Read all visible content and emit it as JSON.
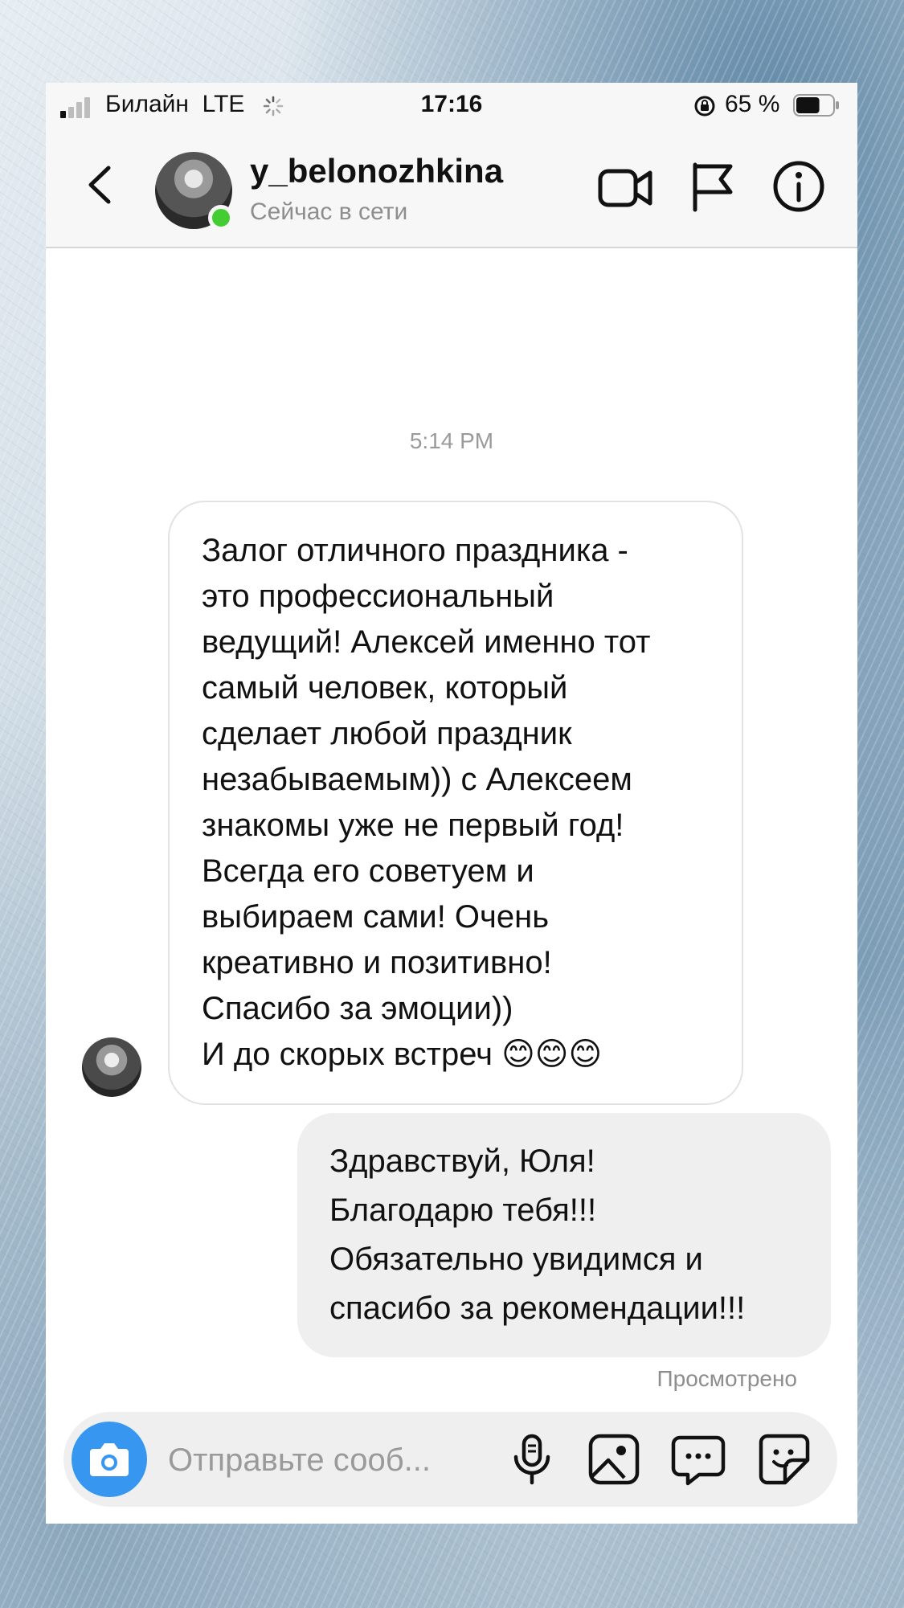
{
  "status_bar": {
    "carrier": "Билайн",
    "network": "LTE",
    "time": "17:16",
    "battery_percent": "65 %",
    "battery_level": 0.65,
    "signal_bars_active": 1
  },
  "header": {
    "username": "y_belonozhkina",
    "presence": "Сейчас в сети",
    "online_color": "#44cc33"
  },
  "thread": {
    "timestamp": "5:14 PM",
    "incoming_message": "Залог отличного праздника -\nэто профессиональный\nведущий! Алексей именно тот\nсамый человек, который\nсделает любой праздник\nнезабываемым)) с Алексеем\nзнакомы уже не первый год!\nВсегда его советуем и\nвыбираем сами! Очень\nкреативно и позитивно!\nСпасибо за эмоции))\nИ до скорых встреч 😊😊😊",
    "outgoing_message": "Здравствуй, Юля!\nБлагодарю тебя!!!\nОбязательно увидимся и\nспасибо за рекомендации!!!",
    "seen_label": "Просмотрено"
  },
  "composer": {
    "placeholder": "Отправьте сооб...",
    "accent_color": "#3797f0"
  },
  "icons": [
    "back-chevron-icon",
    "video-camera-icon",
    "flag-icon",
    "info-icon",
    "camera-icon",
    "microphone-icon",
    "gallery-icon",
    "chat-bubble-icon",
    "sticker-icon"
  ]
}
